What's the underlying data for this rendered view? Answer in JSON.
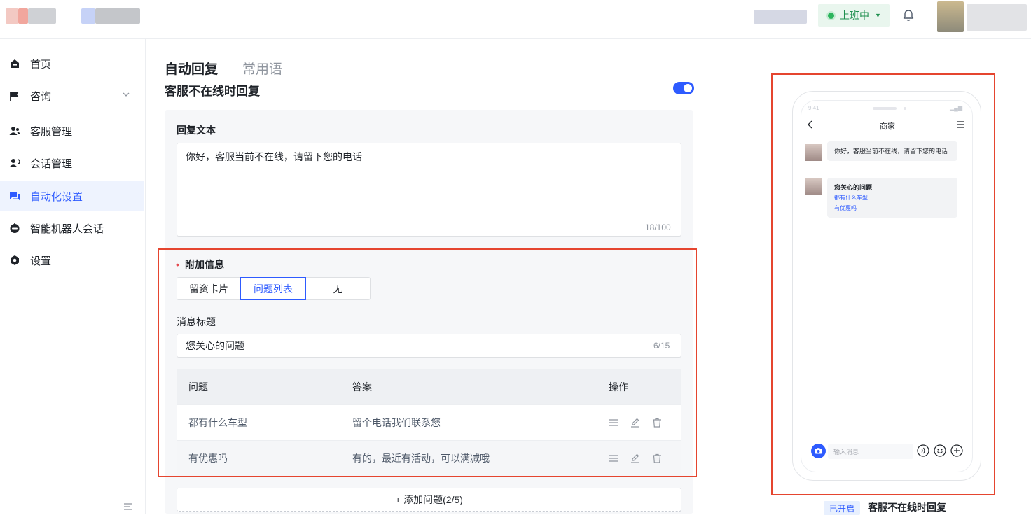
{
  "topbar": {
    "status_label": "上班中"
  },
  "sidebar": {
    "items": [
      {
        "label": "首页"
      },
      {
        "label": "咨询"
      },
      {
        "label": "客服管理"
      },
      {
        "label": "会话管理"
      },
      {
        "label": "自动化设置"
      },
      {
        "label": "智能机器人会话"
      },
      {
        "label": "设置"
      }
    ]
  },
  "tabs": {
    "active": "自动回复",
    "other": "常用语"
  },
  "section": {
    "title": "客服不在线时回复",
    "enabled": true
  },
  "reply": {
    "label": "回复文本",
    "value": "你好，客服当前不在线，请留下您的电话",
    "counter": "18/100"
  },
  "extra": {
    "required_mark": "•",
    "label": "附加信息",
    "options": [
      "留资卡片",
      "问题列表",
      "无"
    ],
    "selected": "问题列表",
    "msg_title_label": "消息标题",
    "msg_title_value": "您关心的问题",
    "msg_title_counter": "6/15",
    "table": {
      "headers": [
        "问题",
        "答案",
        "操作"
      ],
      "rows": [
        {
          "question": "都有什么车型",
          "answer": "留个电话我们联系您"
        },
        {
          "question": "有优惠吗",
          "answer": "有的，最近有活动，可以满减哦"
        }
      ]
    },
    "add_button": "+ 添加问题(2/5)"
  },
  "preview": {
    "status_time": "9:41",
    "header_title": "商家",
    "bubble1": "你好，客服当前不在线，请留下您的电话",
    "bubble2_title": "您关心的问题",
    "bubble2_q1": "都有什么车型",
    "bubble2_q2": "有优惠吗",
    "input_placeholder": "输入消息",
    "tag": "已开启",
    "label": "客服不在线时回复"
  },
  "colors": {
    "accent": "#2e5bff",
    "highlight": "#e5452f",
    "online": "#2cb55d"
  }
}
